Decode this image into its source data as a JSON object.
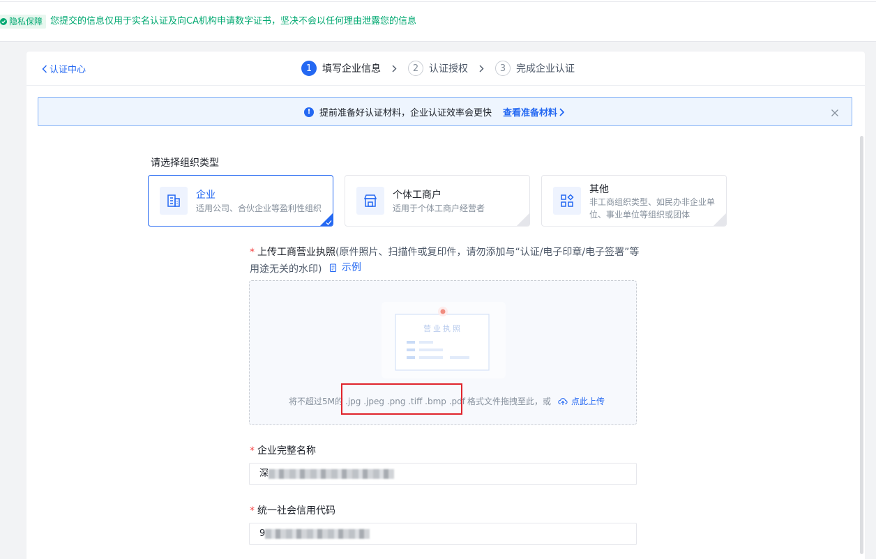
{
  "privacy": {
    "badge": "隐私保障",
    "text": "您提交的信息仅用于实名认证及向CA机构申请数字证书，坚决不会以任何理由泄露您的信息"
  },
  "header": {
    "back_label": "认证中心",
    "steps": [
      {
        "num": "1",
        "label": "填写企业信息",
        "active": true
      },
      {
        "num": "2",
        "label": "认证授权",
        "active": false
      },
      {
        "num": "3",
        "label": "完成企业认证",
        "active": false
      }
    ]
  },
  "tip": {
    "text": "提前准备好认证材料，企业认证效率会更快",
    "link": "查看准备材料"
  },
  "org": {
    "title": "请选择组织类型",
    "options": [
      {
        "name": "企业",
        "desc": "适用公司、合伙企业等盈利性组织",
        "icon": "building-icon",
        "selected": true
      },
      {
        "name": "个体工商户",
        "desc": "适用于个体工商户经营者",
        "icon": "store-icon",
        "selected": false
      },
      {
        "name": "其他",
        "desc": "非工商组织类型、如民办非企业单位、事业单位等组织或团体",
        "icon": "apps-icon",
        "selected": false
      }
    ]
  },
  "upload": {
    "label_strong": "上传工商营业执照",
    "label_rest": "(原件照片、扫描件或复印件，请勿添加与“认证/电子印章/电子签署”等用途无关的水印)",
    "example": "示例",
    "illustration_title": "营业执照",
    "hint_prefix": "将不超过5M的",
    "formats": ".jpg .jpeg .png .tiff .bmp .pdf",
    "hint_suffix": "格式文件拖拽至此，或",
    "upload_btn": "点此上传"
  },
  "fields": {
    "company_name_label": "企业完整名称",
    "company_name_prefix": "深",
    "credit_code_label": "统一社会信用代码",
    "credit_code_prefix": "9"
  },
  "colors": {
    "primary": "#2468f2",
    "success": "#00a870",
    "required": "#f53f3f",
    "highlight": "#e0242c"
  }
}
